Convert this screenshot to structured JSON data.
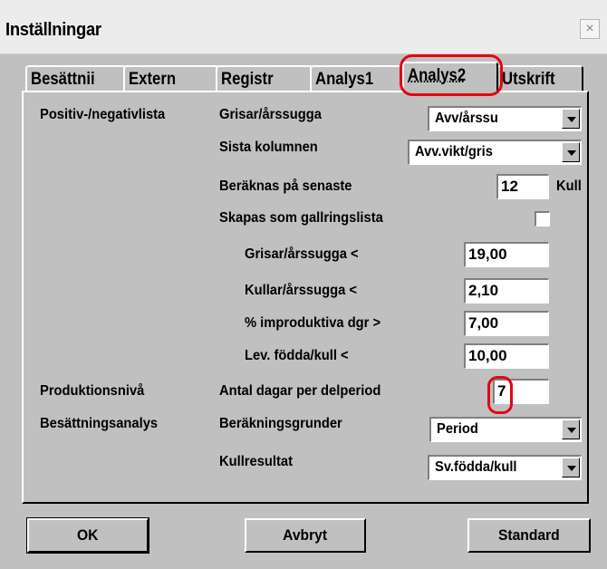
{
  "window": {
    "title": "Inställningar",
    "close_label": "×"
  },
  "tabs": [
    {
      "label": "Besättnii"
    },
    {
      "label": "Extern"
    },
    {
      "label": "Registr"
    },
    {
      "label": "Analys1"
    },
    {
      "label": "Analys2"
    },
    {
      "label": "Utskrift"
    }
  ],
  "active_tab": "Analys2",
  "accent_color": "#e30613",
  "sections": {
    "positiv": "Positiv-/negativlista",
    "produktion": "Produktionsnivå",
    "besattning": "Besättningsanalys"
  },
  "rows": {
    "grisar_arssugga": {
      "label": "Grisar/årssugga",
      "value": "Avv/årssu"
    },
    "sista_kolumnen": {
      "label": "Sista kolumnen",
      "value": "Avv.vikt/gris"
    },
    "beraknas": {
      "label": "Beräknas på senaste",
      "value": "12",
      "unit": "Kull"
    },
    "skapas": {
      "label": "Skapas som gallringslista",
      "checked": false
    },
    "grisar_lt": {
      "label": "Grisar/årssugga <",
      "value": "19,00"
    },
    "kullar_lt": {
      "label": "Kullar/årssugga <",
      "value": "2,10"
    },
    "improduktiva": {
      "label": "% improduktiva dgr >",
      "value": "7,00"
    },
    "lev_fodda": {
      "label": "Lev. födda/kull <",
      "value": "10,00"
    },
    "antal_dagar": {
      "label": "Antal dagar per delperiod",
      "value": "7"
    },
    "berakningsgrunder": {
      "label": "Beräkningsgrunder",
      "value": "Period"
    },
    "kullresultat": {
      "label": "Kullresultat",
      "value": "Sv.födda/kull"
    }
  },
  "buttons": {
    "ok": "OK",
    "cancel": "Avbryt",
    "standard": "Standard"
  }
}
